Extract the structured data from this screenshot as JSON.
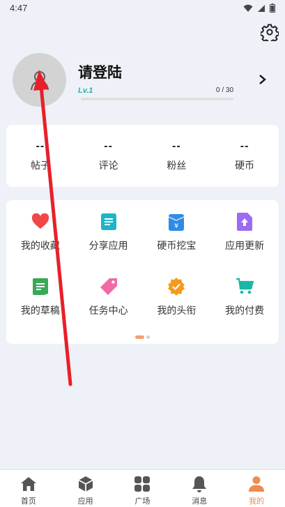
{
  "status_bar": {
    "time": "4:47"
  },
  "profile": {
    "title": "请登陆",
    "level": "Lv.1",
    "progress_text": "0 / 30",
    "progress_fraction": 0
  },
  "stats": [
    {
      "value": "--",
      "label": "帖子"
    },
    {
      "value": "--",
      "label": "评论"
    },
    {
      "value": "--",
      "label": "粉丝"
    },
    {
      "value": "--",
      "label": "硬币"
    }
  ],
  "grid": [
    {
      "label": "我的收藏",
      "icon": "heart-icon",
      "color": "#f04848"
    },
    {
      "label": "分享应用",
      "icon": "share-app-icon",
      "color": "#1cb5c9"
    },
    {
      "label": "硬币挖宝",
      "icon": "coin-treasure-icon",
      "color": "#2f8be6"
    },
    {
      "label": "应用更新",
      "icon": "app-update-icon",
      "color": "#9b6bf2"
    },
    {
      "label": "我的草稿",
      "icon": "draft-icon",
      "color": "#3aa856"
    },
    {
      "label": "任务中心",
      "icon": "task-tag-icon",
      "color": "#f06aa5"
    },
    {
      "label": "我的头衔",
      "icon": "title-badge-icon",
      "color": "#f59a1c"
    },
    {
      "label": "我的付费",
      "icon": "shopping-cart-icon",
      "color": "#1bb7a6"
    }
  ],
  "nav": [
    {
      "label": "首页",
      "icon": "home-icon"
    },
    {
      "label": "应用",
      "icon": "apps-cube-icon"
    },
    {
      "label": "广场",
      "icon": "square-grid-icon"
    },
    {
      "label": "消息",
      "icon": "bell-icon"
    },
    {
      "label": "我的",
      "icon": "person-icon"
    }
  ],
  "colors": {
    "accent": "#f28a4c",
    "level": "#1bb7a6",
    "annotation_arrow": "#e8202a"
  }
}
